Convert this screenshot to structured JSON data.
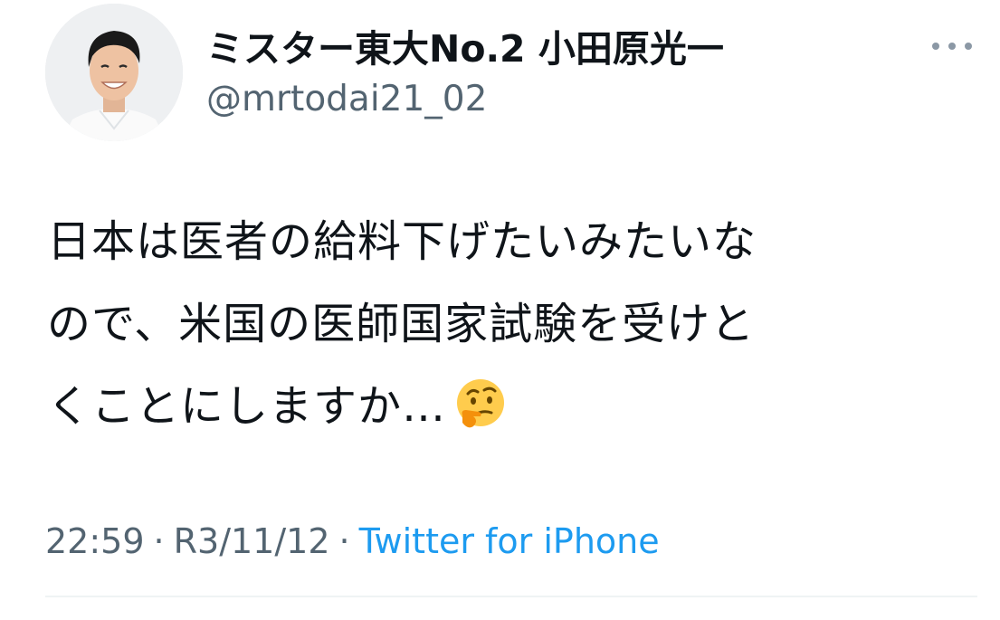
{
  "tweet": {
    "author": {
      "display_name": "ミスター東大No.2 小田原光一",
      "handle": "@mrtodai21_02"
    },
    "more_icon": "more-horizontal-icon",
    "text_lines": [
      "日本は医者の給料下げたいみたいな",
      "ので、米国の医師国家試験を受けと",
      "くことにしますか…"
    ],
    "emoji": "thinking-face-emoji",
    "time": "22:59",
    "separator": "·",
    "date": "R3/11/12",
    "source": "Twitter for iPhone"
  },
  "colors": {
    "text": "#0f1419",
    "secondary": "#536471",
    "link": "#1d9bf0",
    "divider": "#eff3f4"
  }
}
